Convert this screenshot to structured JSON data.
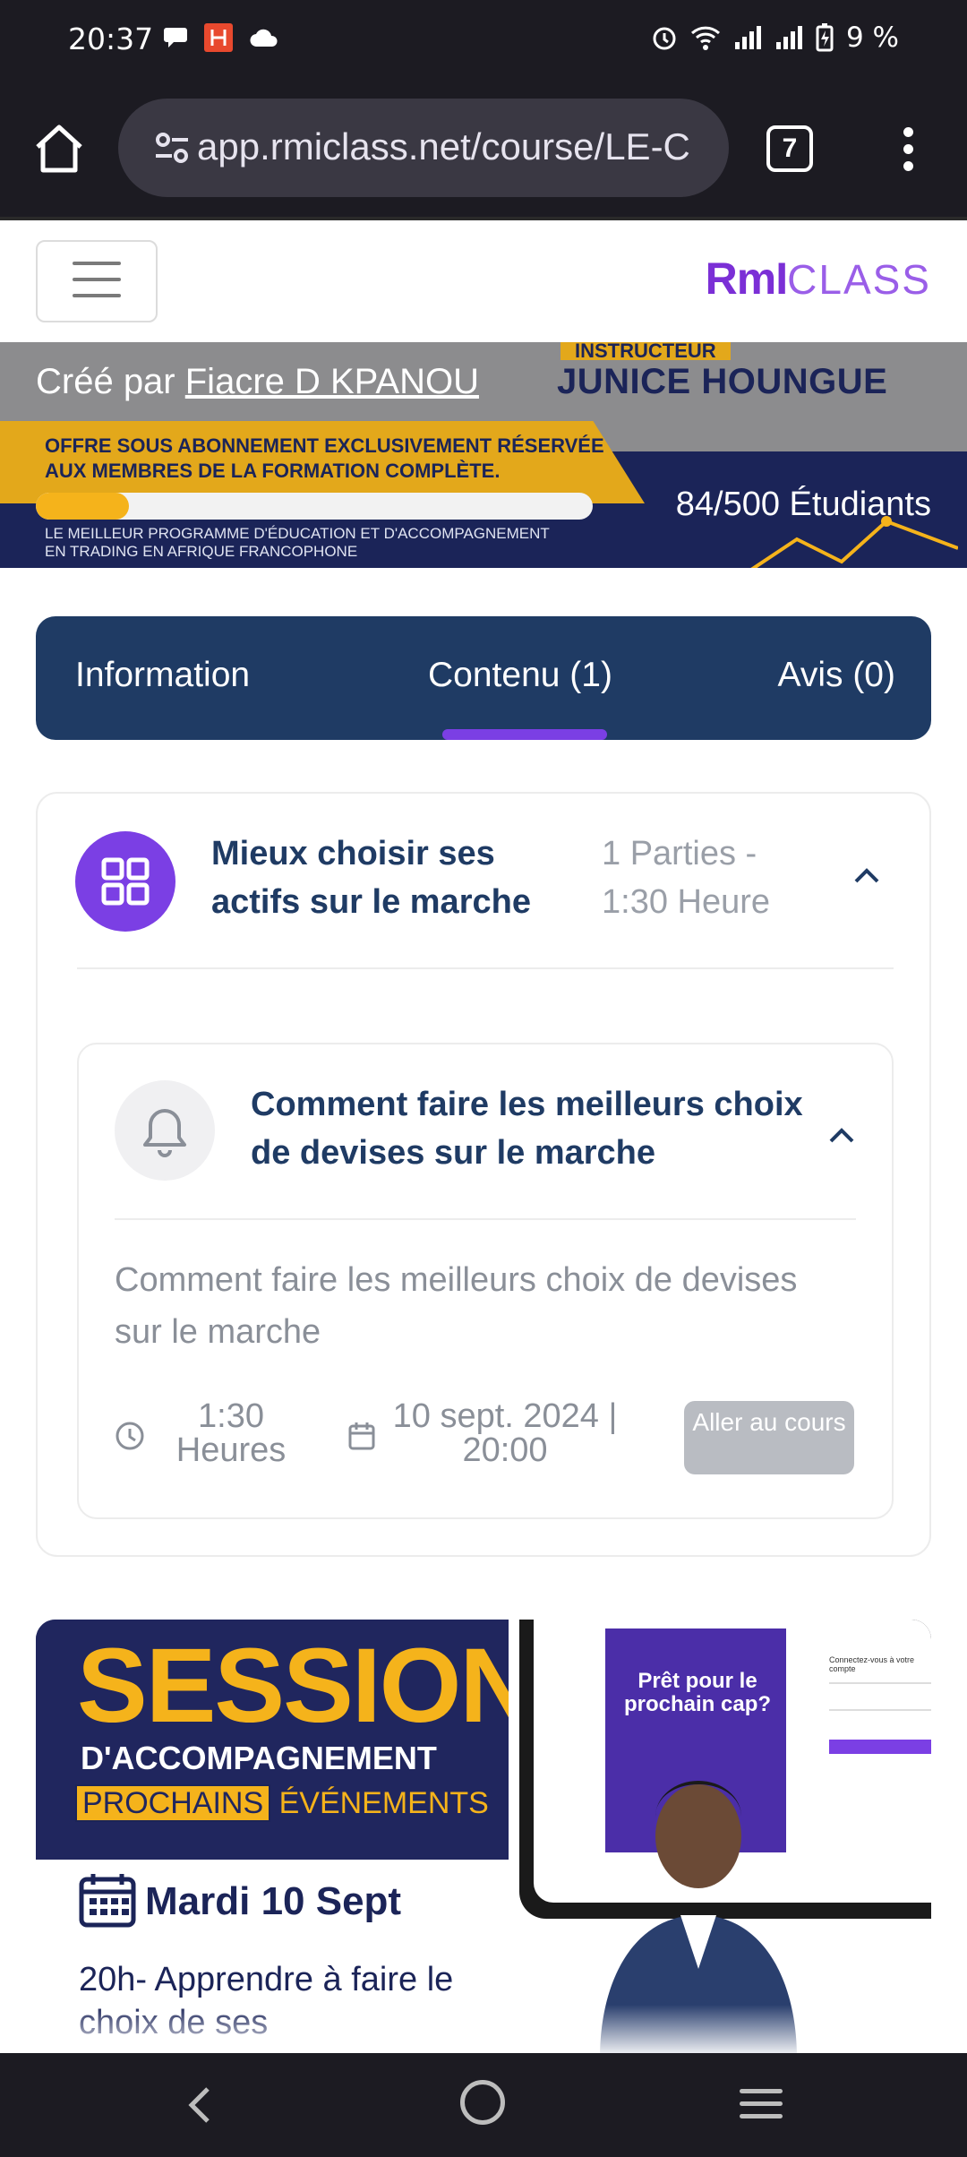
{
  "status_bar": {
    "time": "20:37",
    "battery": "9 %",
    "icons": [
      "chat-bubble-icon",
      "app-h-icon",
      "cloud-icon",
      "alarm-icon",
      "wifi-icon",
      "signal-icon",
      "signal-icon",
      "battery-charging-icon"
    ]
  },
  "browser": {
    "url": "app.rmiclass.net/course/LE-C",
    "tab_count": "7"
  },
  "site": {
    "logo_bold": "RmI",
    "logo_light": "CLASS",
    "brand_color": "#7b2fd6"
  },
  "hero": {
    "created_prefix": "Créé par",
    "creator": "Fiacre D KPANOU",
    "instructor_tag": "INSTRUCTEUR",
    "instructor_name": "JUNICE HOUNGUE",
    "offer_line1": "OFFRE SOUS ABONNEMENT EXCLUSIVEMENT RÉSERVÉE",
    "offer_line2": "AUX MEMBRES DE LA FORMATION COMPLÈTE.",
    "tagline_line1": "LE MEILLEUR PROGRAMME D'ÉDUCATION ET D'ACCOMPAGNEMENT",
    "tagline_line2": "EN TRADING EN AFRIQUE FRANCOPHONE",
    "students": "84/500 Étudiants",
    "enrolled": 84,
    "capacity": 500
  },
  "tabs": [
    {
      "label": "Information",
      "active": false
    },
    {
      "label": "Contenu (1)",
      "active": true
    },
    {
      "label": "Avis (0)",
      "active": false
    }
  ],
  "chapter": {
    "title": "Mieux choisir ses actifs sur le marche",
    "meta": "1 Parties - 1:30 Heure",
    "icon": "grid-icon"
  },
  "lesson": {
    "title": "Comment faire les meilleurs choix de devises sur le marche",
    "description": "Comment faire les meilleurs choix de devises sur le marche",
    "duration": "1:30 Heures",
    "date": "10 sept. 2024 | 20:00",
    "button": "Aller au cours",
    "icon": "bell-icon"
  },
  "promo": {
    "session": "SESSION",
    "accompagnement": "D'ACCOMPAGNEMENT",
    "events_boxed": "PROCHAINS",
    "events_rest": "ÉVÉNEMENTS",
    "date": "Mardi 10 Sept",
    "description": "20h- Apprendre à faire le choix de ses",
    "screen_title": "Prêt pour le prochain cap?",
    "login_label": "Connectez-vous à votre compte"
  },
  "colors": {
    "accent": "#7b3fe4",
    "navy": "#1f3b64",
    "gold": "#f5b31b"
  }
}
